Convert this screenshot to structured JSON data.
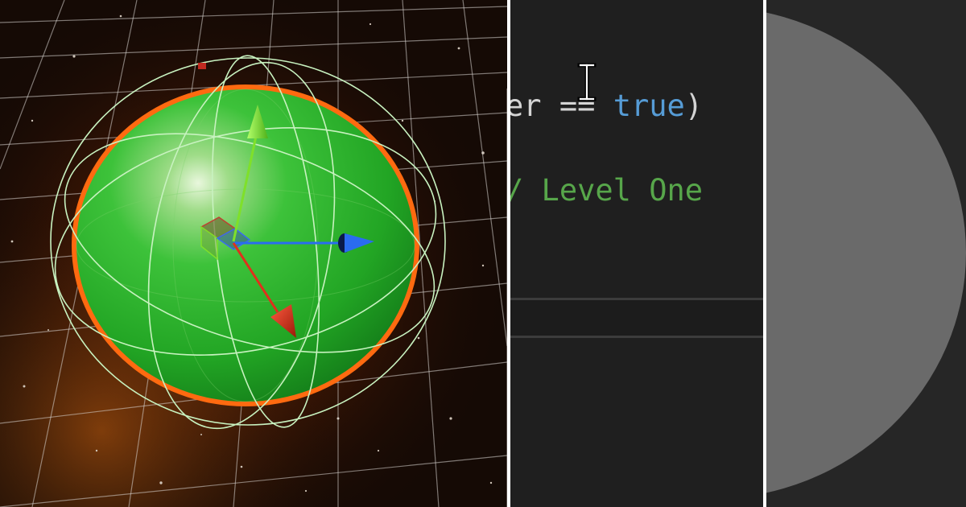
{
  "editor": {
    "line1": {
      "ident": "er",
      "op": "==",
      "keyword": "true",
      "paren": ")"
    },
    "line2": {
      "comment": "/ Level One"
    },
    "colors": {
      "background": "#1f1f1f",
      "keyword": "#569cd6",
      "comment": "#57a64a",
      "text": "#d4d4d4"
    }
  },
  "scene": {
    "selected_object": "sphere",
    "colors": {
      "sphere": "#2fb52f",
      "selection_outline": "#ff6a10",
      "collider": "#b8f0b8",
      "gizmo_x": "#e0301c",
      "gizmo_y": "#7fe02a",
      "gizmo_z": "#2a6cf0"
    },
    "icons": [
      "move-gizmo-icon",
      "sphere-collider-icon"
    ]
  },
  "right_panel": {
    "colors": {
      "background": "#262626",
      "disc": "#6a6a6a"
    }
  }
}
